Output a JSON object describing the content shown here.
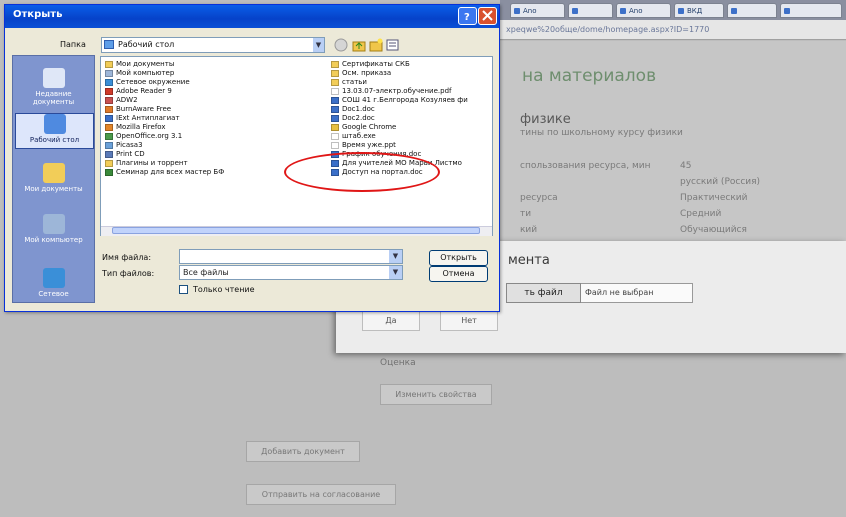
{
  "browser": {
    "tabs": [
      "Ano",
      "",
      "Ano",
      "ВКД",
      ""
    ],
    "url": "xpeqwe%20обще/dome/homepage.aspx?ID=1770",
    "page_title": "на материалов",
    "section_title": "физике",
    "section_desc": "тины по школьному курсу физики",
    "rows": [
      {
        "label": "спользования ресурса, мин",
        "value": "45"
      },
      {
        "label": "",
        "value": "русский (Россия)"
      },
      {
        "label": "ресурса",
        "value": "Практический"
      },
      {
        "label": "ти",
        "value": "Средний"
      },
      {
        "label": "кий",
        "value": "Обучающийся"
      }
    ]
  },
  "upload_panel": {
    "title": "мента",
    "choose_button": "ть файл",
    "no_file": "Файл не выбран",
    "yes": "Да",
    "no": "Нет"
  },
  "lower": {
    "label": "Оценка",
    "buttons": [
      "Изменить свойства",
      "Добавить документ",
      "Отправить на согласование"
    ]
  },
  "dialog": {
    "title": "Открыть",
    "folder_label": "Папка",
    "folder_value": "Рабочий стол",
    "places": [
      "Недавние документы",
      "Рабочий стол",
      "Мои документы",
      "Мой компьютер",
      "Сетевое"
    ],
    "files_col1": [
      "Мои документы",
      "Мой компьютер",
      "Сетевое окружение",
      "Adobe Reader 9",
      "ADW2",
      "BurnAware Free",
      "IExt Антиплагиат",
      "Mozilla Firefox",
      "OpenOffice.org 3.1",
      "Picasa3",
      "Print CD",
      "Плагины и торрент",
      "Семинар для всех мастер БФ"
    ],
    "files_col2": [
      "Сертификаты СКБ",
      "Осм. приказа",
      "статьи",
      "13.03.07-электр.обучение.pdf",
      "СОШ 41 г.Белгорода Козуляев фи",
      "Doc1.doc",
      "Doc2.doc",
      "Google Chrome",
      "штаб.exe",
      "Время уже.ppt",
      "График обучения.doc",
      "Для учителей МО Марьи Листмо",
      "Доступ на портал.doc"
    ],
    "filename_label": "Имя файла:",
    "filename_value": "",
    "filetype_label": "Тип файлов:",
    "filetype_value": "Все файлы",
    "open_button": "Открыть",
    "cancel_button": "Отмена",
    "readonly_label": "Только чтение"
  },
  "colors": {
    "xp_title_blue": "#0642c9",
    "highlight_red": "#e01616",
    "places_bar": "#7f95cf"
  }
}
